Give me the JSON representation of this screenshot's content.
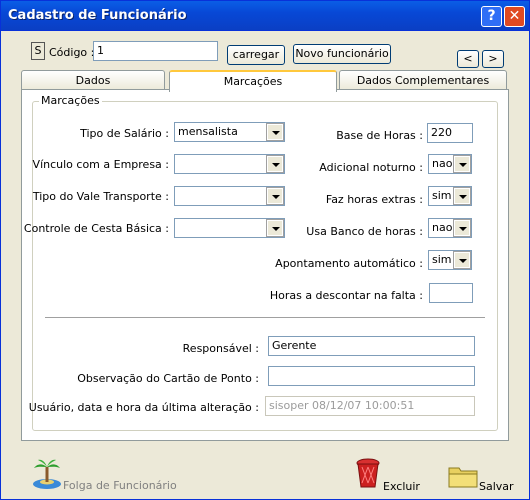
{
  "window": {
    "title": "Cadastro de Funcionário",
    "help_label": "?",
    "close_label": "✕"
  },
  "top": {
    "s_button": "S",
    "codigo_label": "Código :",
    "codigo_value": "1",
    "carregar_button": "carregar",
    "novo_button": "Novo funcionário",
    "prev_button": "<",
    "next_button": ">"
  },
  "tabs": [
    {
      "label": "Dados"
    },
    {
      "label": "Marcações"
    },
    {
      "label": "Dados  Complementares"
    }
  ],
  "group": {
    "title": "Marcações"
  },
  "left_fields": [
    {
      "label": "Tipo de Salário :",
      "value": "mensalista"
    },
    {
      "label": "Vínculo com a Empresa :",
      "value": ""
    },
    {
      "label": "Tipo do Vale Transporte :",
      "value": ""
    },
    {
      "label": "Controle de Cesta Básica :",
      "value": ""
    }
  ],
  "right_fields": [
    {
      "label": "Base de Horas :",
      "value": "220",
      "kind": "input"
    },
    {
      "label": "Adicional noturno :",
      "value": "nao",
      "kind": "select"
    },
    {
      "label": "Faz horas extras :",
      "value": "sim",
      "kind": "select"
    },
    {
      "label": "Usa Banco de horas :",
      "value": "nao",
      "kind": "select"
    },
    {
      "label": "Apontamento automático :",
      "value": "sim",
      "kind": "select"
    },
    {
      "label": "Horas a descontar na falta :",
      "value": "",
      "kind": "input"
    }
  ],
  "bottom_fields": {
    "responsavel_label": "Responsável :",
    "responsavel_value": "Gerente",
    "observacao_label": "Observação do Cartão de Ponto :",
    "observacao_value": "",
    "usuario_label": "Usuário, data e hora da última alteração :",
    "usuario_value": "sisoper 08/12/07 10:00:51"
  },
  "footer": {
    "folga_label": "Folga de Funcionário",
    "excluir_label": "Excluir",
    "salvar_label": "Salvar"
  },
  "colors": {
    "title_bar": "#0a5ee6",
    "face": "#ece9d8",
    "tab_highlight": "#ffc83c",
    "delete_red": "#cc2020",
    "folder_yellow": "#e8d060"
  },
  "icons": {
    "folga": "palm-tree-icon",
    "excluir": "trash-bin-icon",
    "salvar": "folder-icon"
  }
}
